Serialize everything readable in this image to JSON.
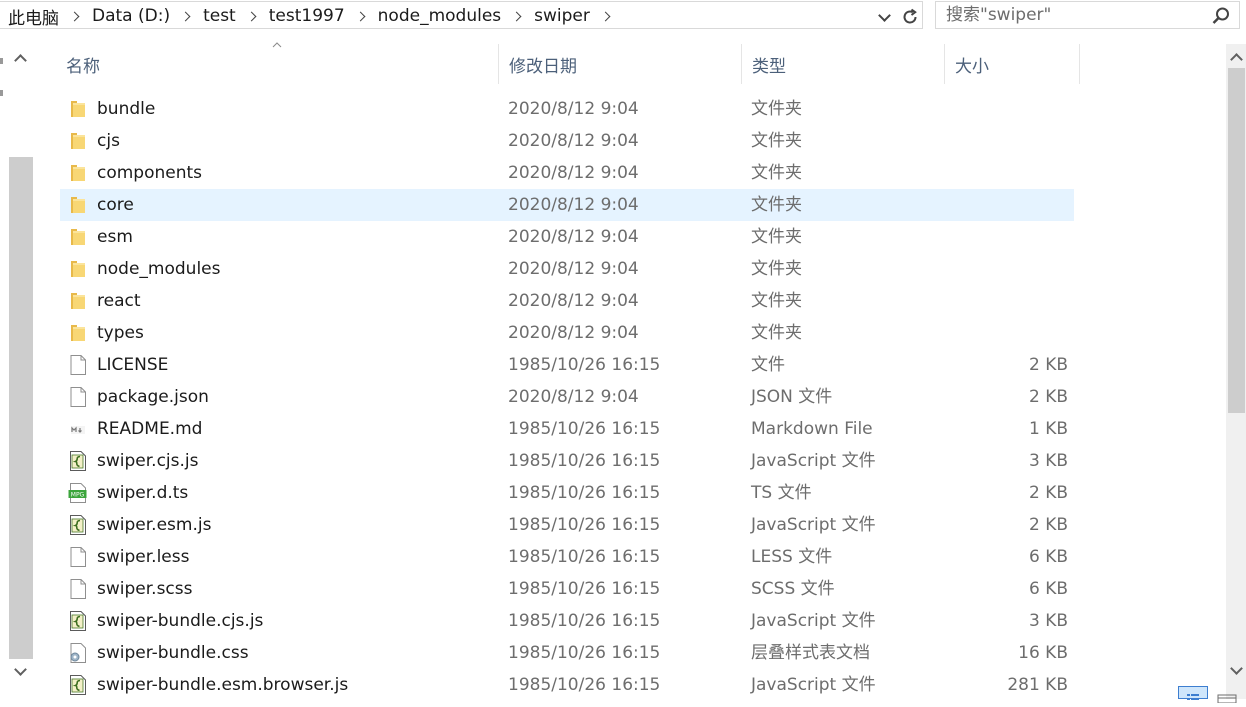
{
  "address": {
    "crumbs": [
      "此电脑",
      "Data (D:)",
      "test",
      "test1997",
      "node_modules",
      "swiper"
    ],
    "search_placeholder": "搜索\"swiper\""
  },
  "columns": {
    "name": "名称",
    "date": "修改日期",
    "type": "类型",
    "size": "大小"
  },
  "files": [
    {
      "name": "bundle",
      "date": "2020/8/12 9:04",
      "type": "文件夹",
      "size": "",
      "icon": "folder-icon"
    },
    {
      "name": "cjs",
      "date": "2020/8/12 9:04",
      "type": "文件夹",
      "size": "",
      "icon": "folder-icon"
    },
    {
      "name": "components",
      "date": "2020/8/12 9:04",
      "type": "文件夹",
      "size": "",
      "icon": "folder-icon"
    },
    {
      "name": "core",
      "date": "2020/8/12 9:04",
      "type": "文件夹",
      "size": "",
      "icon": "folder-icon",
      "selected": true
    },
    {
      "name": "esm",
      "date": "2020/8/12 9:04",
      "type": "文件夹",
      "size": "",
      "icon": "folder-icon"
    },
    {
      "name": "node_modules",
      "date": "2020/8/12 9:04",
      "type": "文件夹",
      "size": "",
      "icon": "folder-icon"
    },
    {
      "name": "react",
      "date": "2020/8/12 9:04",
      "type": "文件夹",
      "size": "",
      "icon": "folder-icon"
    },
    {
      "name": "types",
      "date": "2020/8/12 9:04",
      "type": "文件夹",
      "size": "",
      "icon": "folder-icon"
    },
    {
      "name": "LICENSE",
      "date": "1985/10/26 16:15",
      "type": "文件",
      "size": "2 KB",
      "icon": "file-icon"
    },
    {
      "name": "package.json",
      "date": "2020/8/12 9:04",
      "type": "JSON 文件",
      "size": "2 KB",
      "icon": "file-icon"
    },
    {
      "name": "README.md",
      "date": "1985/10/26 16:15",
      "type": "Markdown File",
      "size": "1 KB",
      "icon": "markdown-file-icon"
    },
    {
      "name": "swiper.cjs.js",
      "date": "1985/10/26 16:15",
      "type": "JavaScript 文件",
      "size": "3 KB",
      "icon": "javascript-file-icon"
    },
    {
      "name": "swiper.d.ts",
      "date": "1985/10/26 16:15",
      "type": "TS 文件",
      "size": "2 KB",
      "icon": "ts-file-icon"
    },
    {
      "name": "swiper.esm.js",
      "date": "1985/10/26 16:15",
      "type": "JavaScript 文件",
      "size": "2 KB",
      "icon": "javascript-file-icon"
    },
    {
      "name": "swiper.less",
      "date": "1985/10/26 16:15",
      "type": "LESS 文件",
      "size": "6 KB",
      "icon": "file-icon"
    },
    {
      "name": "swiper.scss",
      "date": "1985/10/26 16:15",
      "type": "SCSS 文件",
      "size": "6 KB",
      "icon": "file-icon"
    },
    {
      "name": "swiper-bundle.cjs.js",
      "date": "1985/10/26 16:15",
      "type": "JavaScript 文件",
      "size": "3 KB",
      "icon": "javascript-file-icon"
    },
    {
      "name": "swiper-bundle.css",
      "date": "1985/10/26 16:15",
      "type": "层叠样式表文档",
      "size": "16 KB",
      "icon": "css-file-icon"
    },
    {
      "name": "swiper-bundle.esm.browser.js",
      "date": "1985/10/26 16:15",
      "type": "JavaScript 文件",
      "size": "281 KB",
      "icon": "javascript-file-icon"
    }
  ],
  "colors": {
    "selection": "#e5f3ff",
    "header_text": "#4c607a",
    "folder": "#f8d775"
  }
}
